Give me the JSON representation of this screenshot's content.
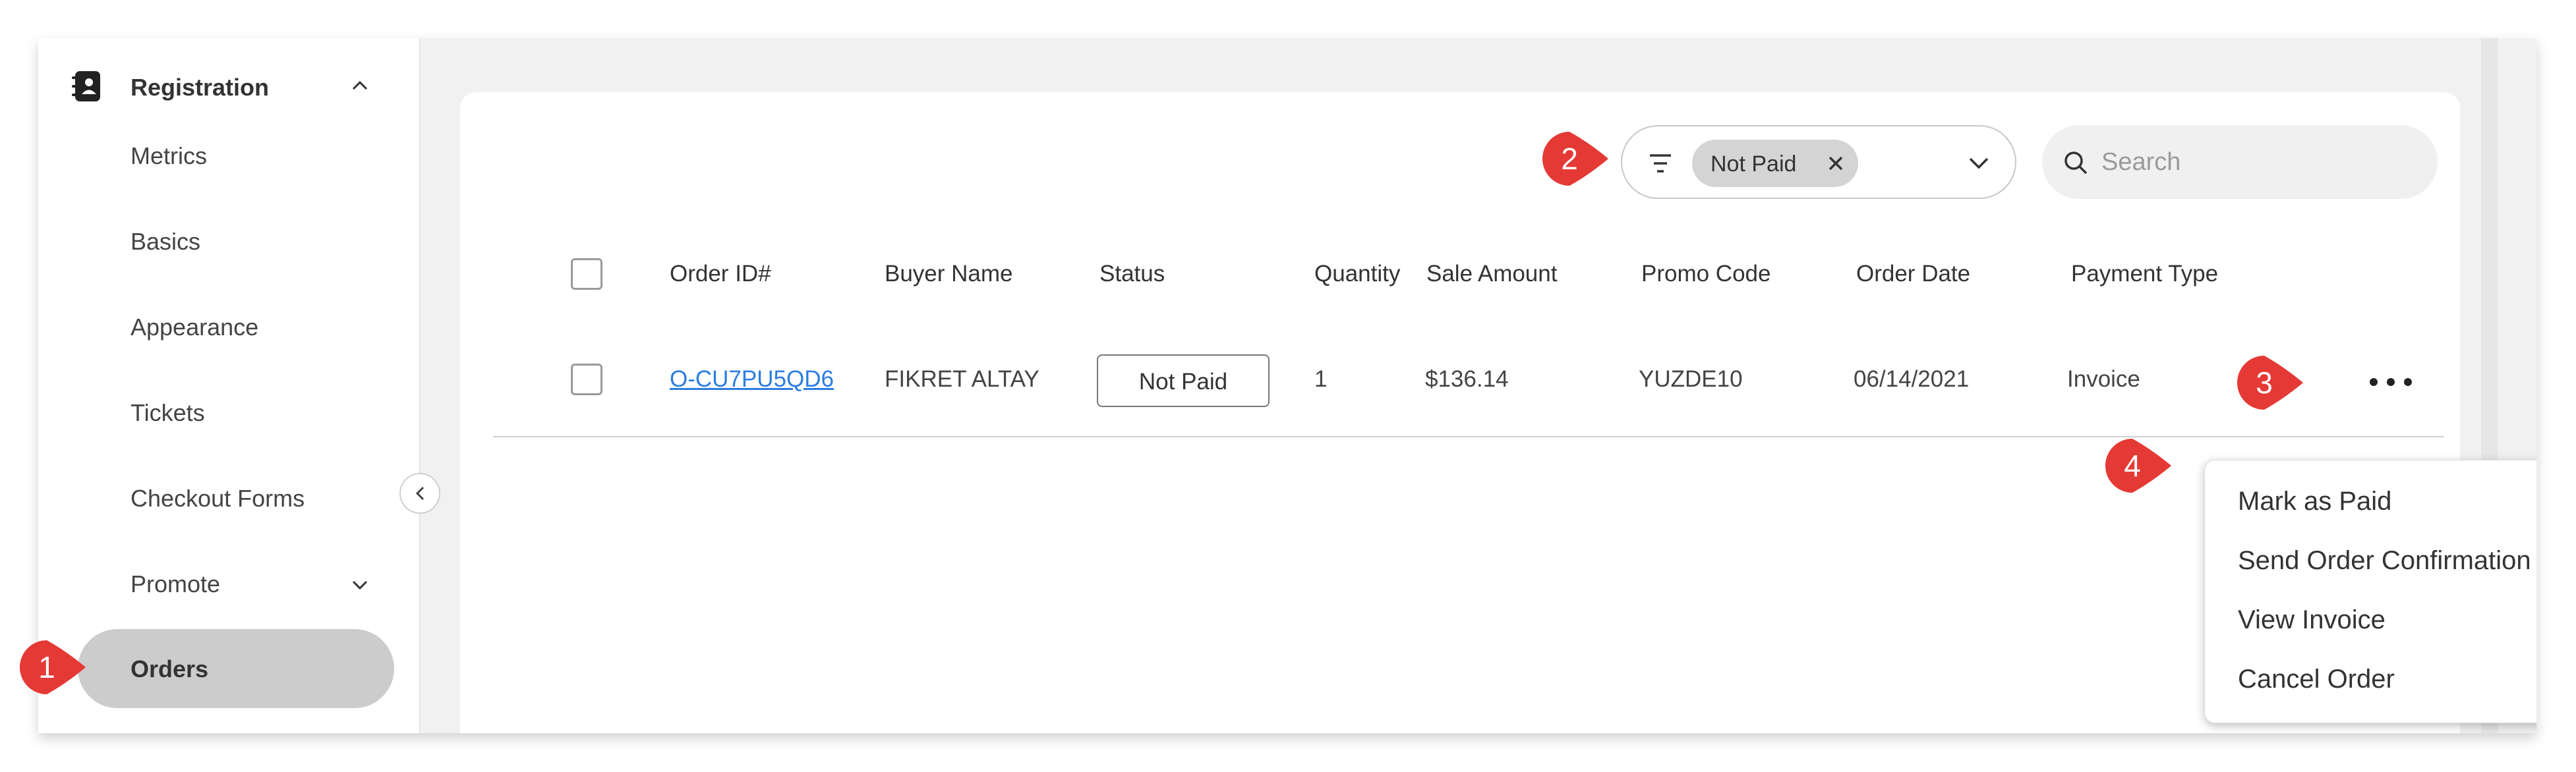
{
  "sidebar": {
    "title": "Registration",
    "items": [
      {
        "label": "Metrics"
      },
      {
        "label": "Basics"
      },
      {
        "label": "Appearance"
      },
      {
        "label": "Tickets"
      },
      {
        "label": "Checkout Forms"
      },
      {
        "label": "Promote"
      },
      {
        "label": "Orders"
      }
    ]
  },
  "filter": {
    "chip_label": "Not Paid"
  },
  "search": {
    "placeholder": "Search"
  },
  "table": {
    "columns": [
      "Order ID#",
      "Buyer Name",
      "Status",
      "Quantity",
      "Sale Amount",
      "Promo Code",
      "Order Date",
      "Payment Type"
    ],
    "rows": [
      {
        "order_id": "O-CU7PU5QD6",
        "buyer": "FIKRET ALTAY",
        "status": "Not Paid",
        "quantity": "1",
        "sale_amount": "$136.14",
        "promo_code": "YUZDE10",
        "order_date": "06/14/2021",
        "payment_type": "Invoice"
      }
    ]
  },
  "menu": {
    "items": [
      {
        "label": "Mark as Paid"
      },
      {
        "label": "Send Order Confirmation"
      },
      {
        "label": "View Invoice"
      },
      {
        "label": "Cancel Order"
      }
    ]
  },
  "markers": [
    {
      "label": "1"
    },
    {
      "label": "2"
    },
    {
      "label": "3"
    },
    {
      "label": "4"
    }
  ],
  "colors": {
    "marker": "#e53935",
    "link": "#2b7de0",
    "active_nav": "#cccccc"
  }
}
